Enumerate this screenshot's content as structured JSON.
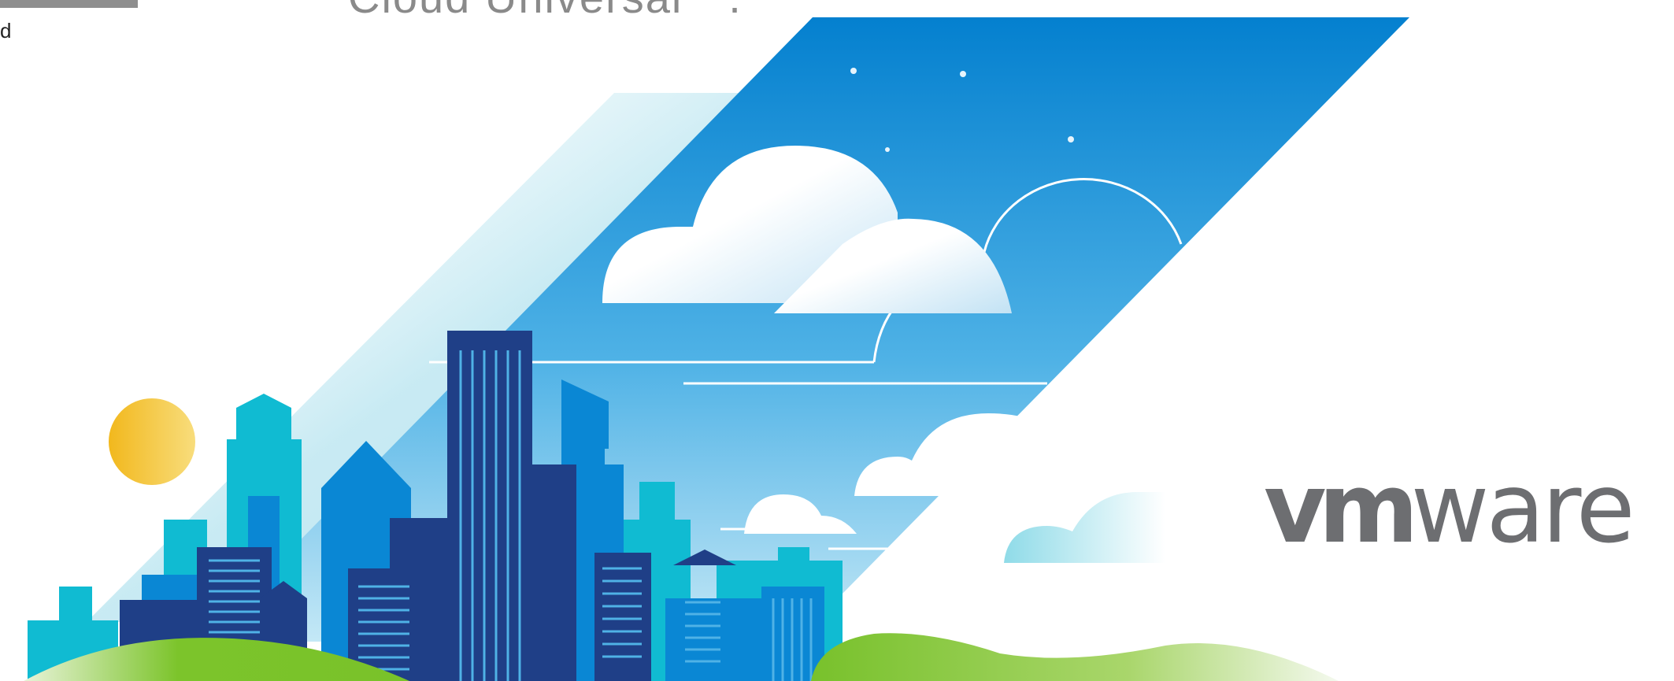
{
  "header": {
    "title_fragment": "Cloud Universal™.",
    "left_cut_letter": "d"
  },
  "brand": {
    "logo_part1": "vm",
    "logo_part2": "ware",
    "logo_color": "#6d6e71"
  },
  "colors": {
    "sky_top": "#0480cf",
    "sky_bottom": "#b9e3f5",
    "sun": "#f5c42c",
    "grass": "#7ac52a",
    "navy_building": "#1f3f87",
    "blue_building": "#0a87d4",
    "teal_building": "#10bbd2"
  }
}
